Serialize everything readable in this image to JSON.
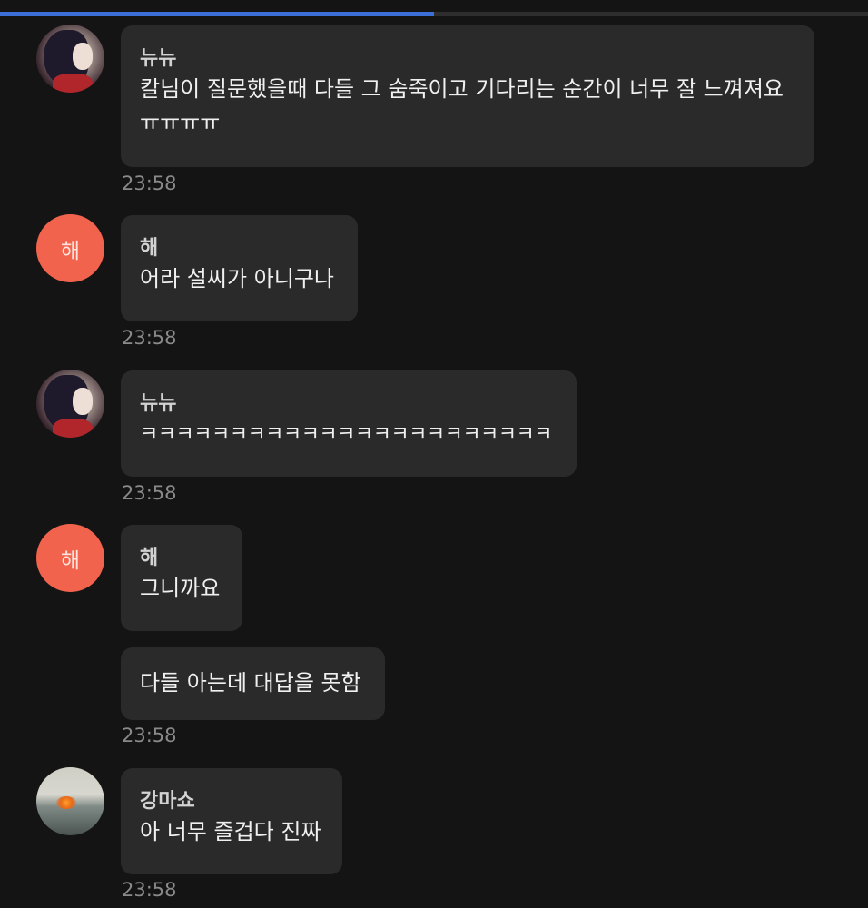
{
  "progress": {
    "fraction": 0.5
  },
  "colors": {
    "background": "#141414",
    "bubble": "#2a2a2a",
    "avatar_letter_bg": "#f2634d",
    "progress_fill": "#3d6fd8",
    "timestamp": "#8a8a8a"
  },
  "messages": [
    {
      "sender": "뉴뉴",
      "avatar": "anime-portrait-avatar",
      "text": "칼님이 질문했을때 다들 그 숨죽이고 기다리는 순간이 너무 잘 느껴져요\nㅠㅠㅠㅠ",
      "time": "23:58"
    },
    {
      "sender": "해",
      "avatar_letter": "해",
      "text": "어라 설씨가 아니구나",
      "time": "23:58"
    },
    {
      "sender": "뉴뉴",
      "avatar": "anime-portrait-avatar",
      "text": "ㅋㅋㅋㅋㅋㅋㅋㅋㅋㅋㅋㅋㅋㅋㅋㅋㅋㅋㅋㅋㅋㅋㅋ",
      "time": "23:58"
    },
    {
      "sender": "해",
      "avatar_letter": "해",
      "text": "그니까요",
      "followup_text": "다들 아는데 대답을 못함",
      "time": "23:58"
    },
    {
      "sender": "강마쇼",
      "avatar": "sea-photo-avatar",
      "text": "아 너무 즐겁다 진짜",
      "time": "23:58"
    }
  ]
}
